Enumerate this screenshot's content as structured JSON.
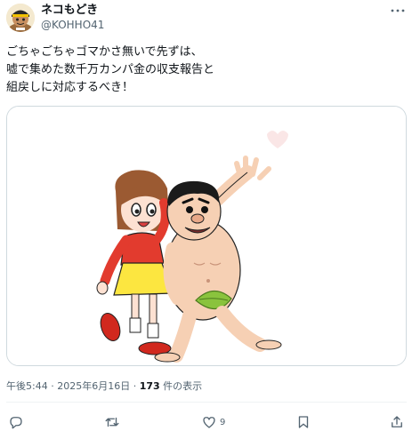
{
  "author": {
    "display_name": "ネコもどき",
    "handle": "@KOHHO41"
  },
  "tweet": {
    "lines": [
      "ごちゃごちゃゴマかさ無いで先ずは、",
      "嘘で集めた数千万カンパ金の収支報告と",
      "組戻しに対応するべき！"
    ]
  },
  "meta": {
    "time": "午後5:44",
    "separator": "·",
    "date": "2025年6月16日",
    "views_count": "173",
    "views_label": "件の表示"
  },
  "actions": {
    "reply_count": "",
    "retweet_count": "",
    "like_count": "9",
    "bookmark_count": ""
  },
  "icons": {
    "more": "more-horizontal-icon",
    "reply": "reply-icon",
    "retweet": "retweet-icon",
    "like": "heart-icon",
    "bookmark": "bookmark-icon",
    "share": "share-icon"
  },
  "colors": {
    "text": "#0f1419",
    "secondary": "#536471",
    "border": "#cfd9de"
  }
}
